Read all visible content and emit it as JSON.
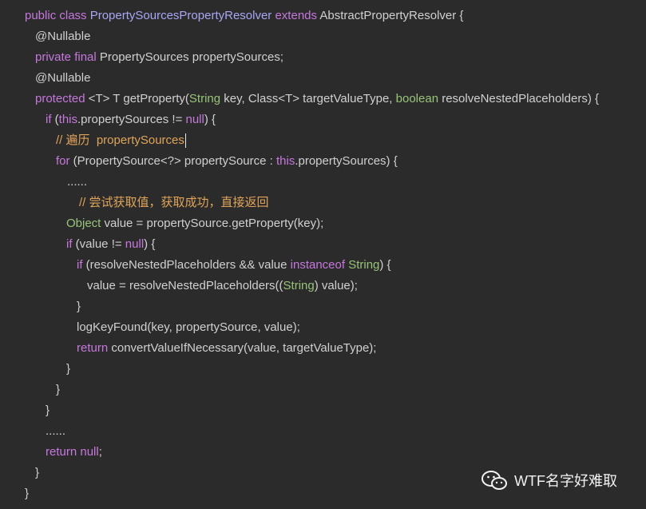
{
  "code_lines": [
    [
      {
        "t": "public class ",
        "c": "kw"
      },
      {
        "t": "PropertySourcesPropertyResolver",
        "c": "cls"
      },
      {
        "t": " extends ",
        "c": "kw"
      },
      {
        "t": "AbstractPropertyResolver {",
        "c": "pl"
      }
    ],
    [
      {
        "t": "@Nullable",
        "c": "pl"
      }
    ],
    [
      {
        "t": "private final ",
        "c": "kw"
      },
      {
        "t": "PropertySources propertySources;",
        "c": "pl"
      }
    ],
    [
      {
        "t": "@Nullable",
        "c": "pl"
      }
    ],
    [
      {
        "t": "protected ",
        "c": "kw"
      },
      {
        "t": "<T> T getProperty(",
        "c": "pl"
      },
      {
        "t": "String",
        "c": "tp"
      },
      {
        "t": " key, Class<T> targetValueType, ",
        "c": "pl"
      },
      {
        "t": "boolean",
        "c": "tp"
      },
      {
        "t": " resolveNestedPlaceholders) {",
        "c": "pl"
      }
    ],
    [
      {
        "t": "if",
        "c": "kw"
      },
      {
        "t": " (",
        "c": "pl"
      },
      {
        "t": "this",
        "c": "kw"
      },
      {
        "t": ".propertySources != ",
        "c": "pl"
      },
      {
        "t": "null",
        "c": "kw"
      },
      {
        "t": ") {",
        "c": "pl"
      }
    ],
    [
      {
        "t": "// 遍历  propertySources",
        "c": "cm"
      }
    ],
    [
      {
        "t": "for",
        "c": "kw"
      },
      {
        "t": " (PropertySource<?> propertySource : ",
        "c": "pl"
      },
      {
        "t": "this",
        "c": "kw"
      },
      {
        "t": ".propertySources) {",
        "c": "pl"
      }
    ],
    [
      {
        "t": "......",
        "c": "pl"
      }
    ],
    [
      {
        "t": "// 尝试获取值，获取成功，直接返回",
        "c": "cm"
      }
    ],
    [
      {
        "t": "Object",
        "c": "tp"
      },
      {
        "t": " value = propertySource.getProperty(key);",
        "c": "pl"
      }
    ],
    [
      {
        "t": "if",
        "c": "kw"
      },
      {
        "t": " (value != ",
        "c": "pl"
      },
      {
        "t": "null",
        "c": "kw"
      },
      {
        "t": ") {",
        "c": "pl"
      }
    ],
    [
      {
        "t": "if",
        "c": "kw"
      },
      {
        "t": " (resolveNestedPlaceholders && value ",
        "c": "pl"
      },
      {
        "t": "instanceof",
        "c": "kw"
      },
      {
        "t": " ",
        "c": "pl"
      },
      {
        "t": "String",
        "c": "tp"
      },
      {
        "t": ") {",
        "c": "pl"
      }
    ],
    [
      {
        "t": "value = resolveNestedPlaceholders((",
        "c": "pl"
      },
      {
        "t": "String",
        "c": "tp"
      },
      {
        "t": ") value);",
        "c": "pl"
      }
    ],
    [
      {
        "t": "}",
        "c": "pl"
      }
    ],
    [
      {
        "t": "logKeyFound(key, propertySource, value);",
        "c": "pl"
      }
    ],
    [
      {
        "t": "return",
        "c": "kw"
      },
      {
        "t": " convertValueIfNecessary(value, targetValueType);",
        "c": "pl"
      }
    ],
    [
      {
        "t": "}",
        "c": "pl"
      }
    ],
    [
      {
        "t": "}",
        "c": "pl"
      }
    ],
    [
      {
        "t": "}",
        "c": "pl"
      }
    ],
    [
      {
        "t": "......",
        "c": "pl"
      }
    ],
    [
      {
        "t": "return",
        "c": "kw"
      },
      {
        "t": " ",
        "c": "pl"
      },
      {
        "t": "null",
        "c": "kw"
      },
      {
        "t": ";",
        "c": "pl"
      }
    ],
    [
      {
        "t": "}",
        "c": "pl"
      }
    ],
    [
      {
        "t": "}",
        "c": "pl"
      }
    ]
  ],
  "watermark": {
    "icon": "wechat-icon",
    "text": "WTF名字好难取"
  },
  "colors": {
    "background": "#2b2b2b",
    "keyword": "#c678dd",
    "class_name": "#a9a7f5",
    "type": "#98c379",
    "comment": "#e0a45a",
    "plain": "#d0d0d0"
  }
}
